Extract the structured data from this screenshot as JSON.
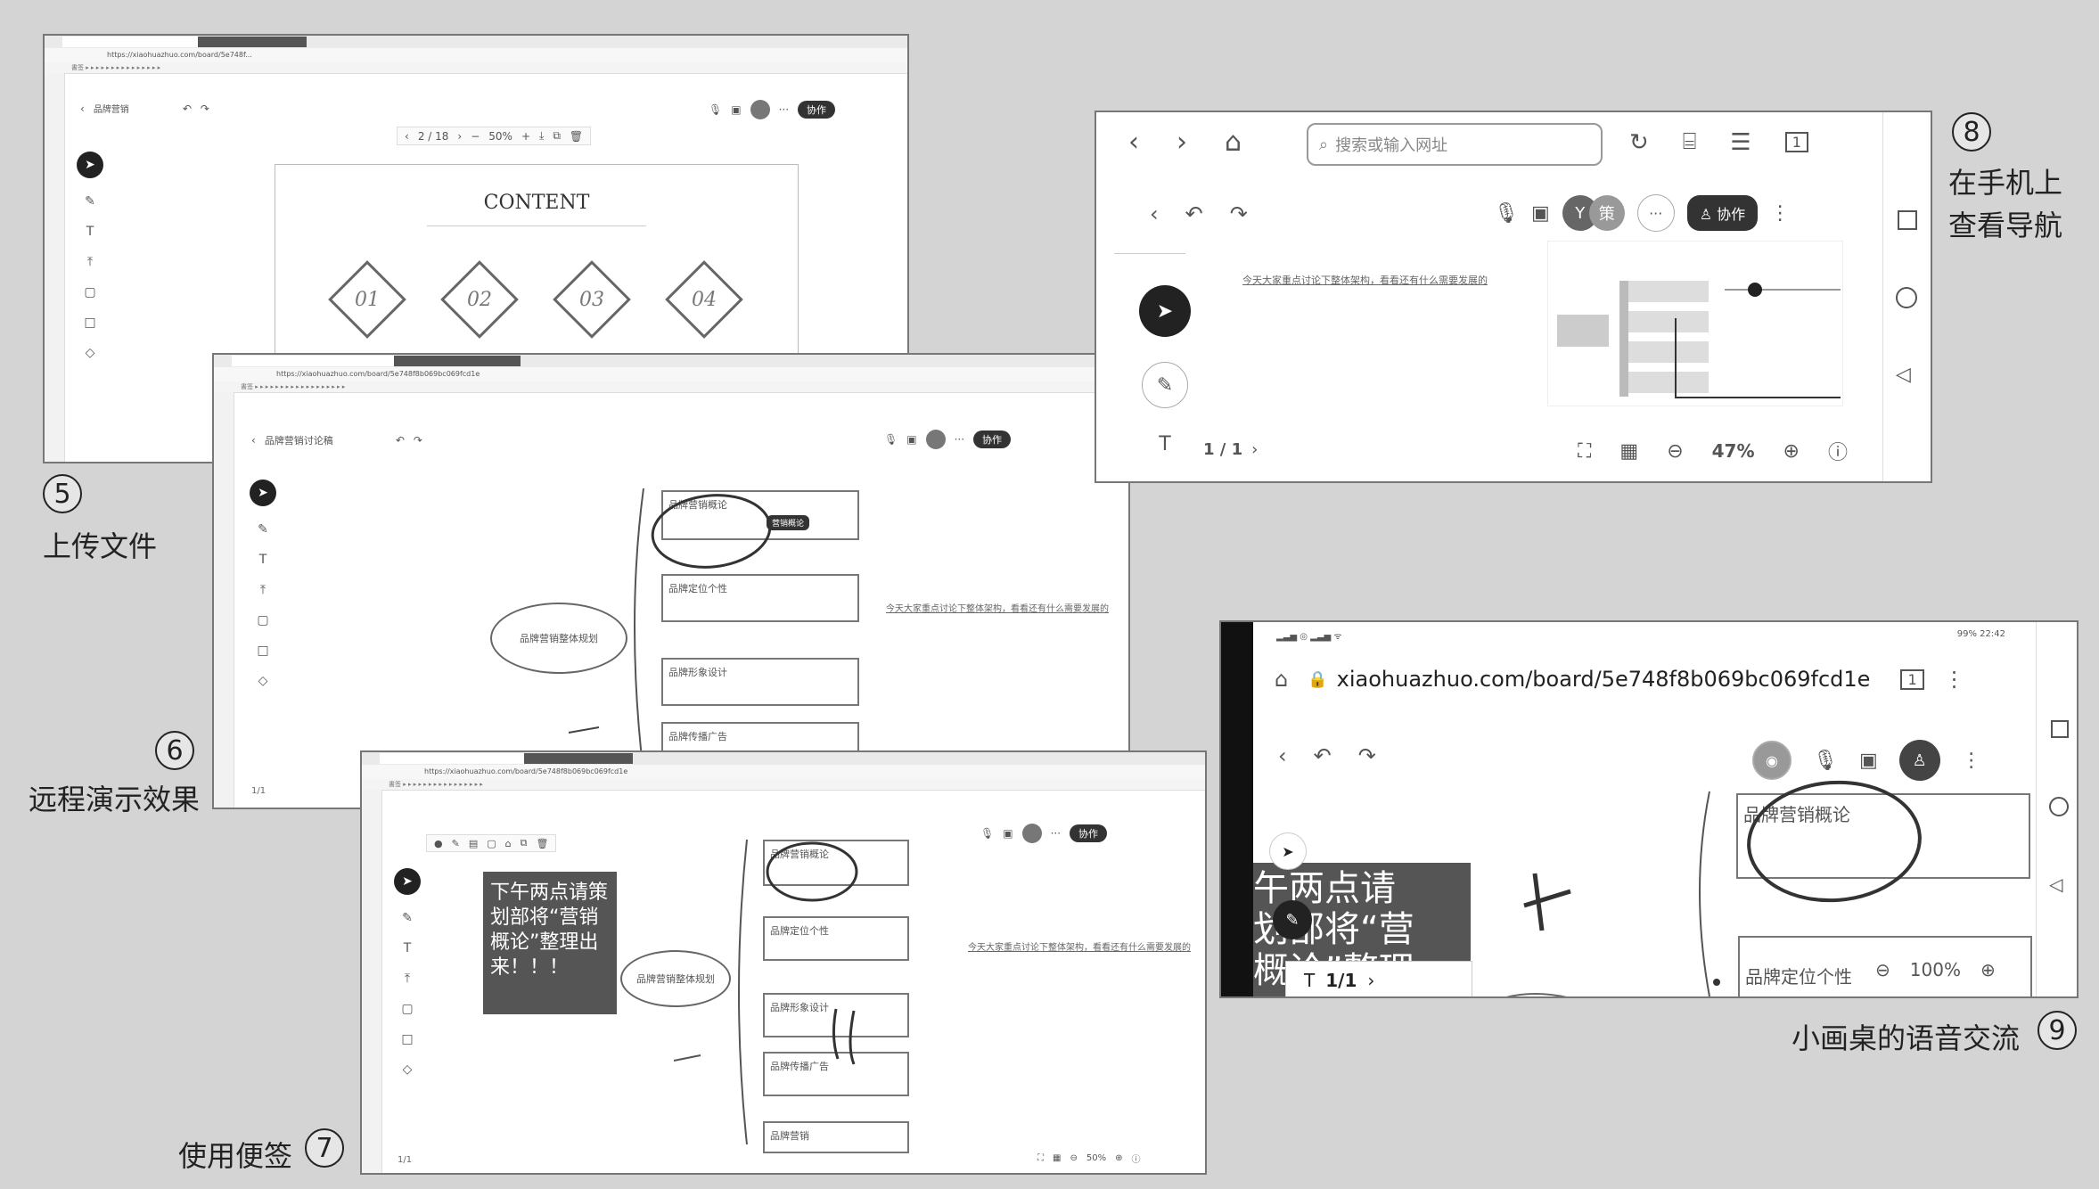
{
  "captions": {
    "c5_num": "5",
    "c5_label": "上传文件",
    "c6_num": "6",
    "c6_label": "远程演示效果",
    "c7_label": "使用便签",
    "c7_num": "7",
    "c8_num": "8",
    "c8_line1": "在手机上",
    "c8_line2": "查看导航",
    "c9_label": "小画桌的语音交流",
    "c9_num": "9"
  },
  "win5": {
    "page_counter": "2 / 18",
    "zoom": "50%",
    "slide_title": "CONTENT",
    "diamonds": [
      "01",
      "02",
      "03",
      "04"
    ],
    "share_btn": "协作"
  },
  "win6": {
    "back_label": "品牌营销讨论稿",
    "share_btn": "协作",
    "center_node": "品牌营销整体规划",
    "node1": "品牌营销概论",
    "node2": "品牌定位个性",
    "node3": "品牌形象设计",
    "node4": "品牌传播广告",
    "label_bubble": "营销概论",
    "note_link": "今天大家重点讨论下整体架构，看看还有什么需要发展的",
    "page": "1/1"
  },
  "win7": {
    "sticky_note": "下午两点请策划部将“营销概论”整理出来！！！",
    "center_node": "品牌营销整体规划",
    "node1": "品牌营销概论",
    "node2": "品牌定位个性",
    "node3": "品牌形象设计",
    "node4": "品牌传播广告",
    "node5": "品牌营销",
    "note_link": "今天大家重点讨论下整体架构，看看还有什么需要发展的",
    "zoom": "50%",
    "share_btn": "协作",
    "page": "1/1"
  },
  "win8": {
    "search_placeholder": "搜索或输入网址",
    "tab_count": "1",
    "avatar1": "Y",
    "avatar2": "策",
    "collab_btn": "协作",
    "note_link": "今天大家重点讨论下整体架构，看看还有什么需要发展的",
    "page": "1 / 1",
    "zoom": "47%"
  },
  "win9": {
    "status_right": "99% 22:42",
    "url": "xiaohuazhuo.com/board/5e748f8b069bc069fcd1e",
    "tab_count": "1",
    "node1": "品牌营销概论",
    "node2": "品牌定位个性",
    "sticky_partial_1": "午两点请",
    "sticky_partial_2": "划部将“营",
    "sticky_partial_3": "概论”整理",
    "page": "1/1",
    "zoom": "100%"
  }
}
